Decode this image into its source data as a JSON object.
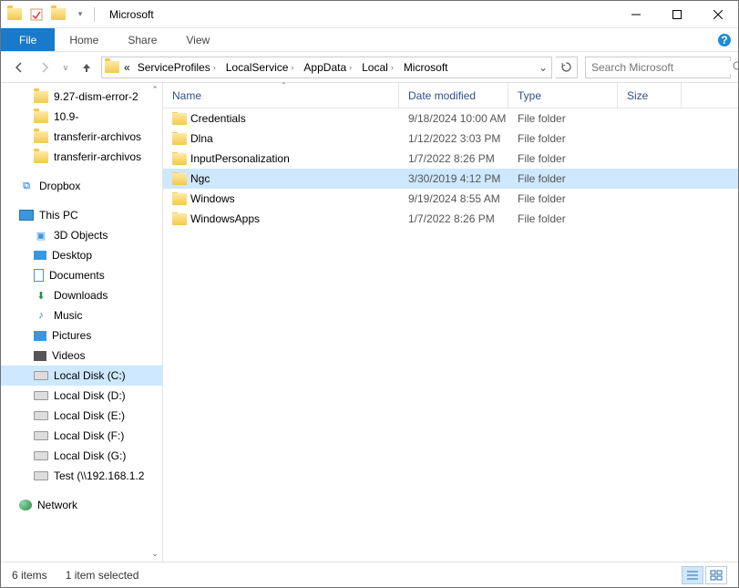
{
  "window": {
    "title": "Microsoft"
  },
  "ribbon": {
    "file": "File",
    "home": "Home",
    "share": "Share",
    "view": "View"
  },
  "breadcrumbs": [
    "ServiceProfiles",
    "LocalService",
    "AppData",
    "Local",
    "Microsoft"
  ],
  "search": {
    "placeholder": "Search Microsoft"
  },
  "tree": {
    "quick": [
      "9.27-dism-error-2",
      "10.9-",
      "transferir-archivos",
      "transferir-archivos"
    ],
    "dropbox": "Dropbox",
    "thispc": "This PC",
    "pc_items": [
      {
        "label": "3D Objects",
        "icon": "cube"
      },
      {
        "label": "Desktop",
        "icon": "desktop"
      },
      {
        "label": "Documents",
        "icon": "doc"
      },
      {
        "label": "Downloads",
        "icon": "down"
      },
      {
        "label": "Music",
        "icon": "music"
      },
      {
        "label": "Pictures",
        "icon": "pic"
      },
      {
        "label": "Videos",
        "icon": "video"
      },
      {
        "label": "Local Disk (C:)",
        "icon": "disk",
        "selected": true
      },
      {
        "label": "Local Disk (D:)",
        "icon": "disk"
      },
      {
        "label": "Local Disk (E:)",
        "icon": "disk"
      },
      {
        "label": "Local Disk (F:)",
        "icon": "disk"
      },
      {
        "label": "Local Disk (G:)",
        "icon": "disk"
      },
      {
        "label": "Test (\\\\192.168.1.2",
        "icon": "disk"
      }
    ],
    "network": "Network"
  },
  "columns": {
    "name": "Name",
    "date": "Date modified",
    "type": "Type",
    "size": "Size"
  },
  "files": [
    {
      "name": "Credentials",
      "date": "9/18/2024 10:00 AM",
      "type": "File folder"
    },
    {
      "name": "Dlna",
      "date": "1/12/2022 3:03 PM",
      "type": "File folder"
    },
    {
      "name": "InputPersonalization",
      "date": "1/7/2022 8:26 PM",
      "type": "File folder"
    },
    {
      "name": "Ngc",
      "date": "3/30/2019 4:12 PM",
      "type": "File folder",
      "selected": true
    },
    {
      "name": "Windows",
      "date": "9/19/2024 8:55 AM",
      "type": "File folder"
    },
    {
      "name": "WindowsApps",
      "date": "1/7/2022 8:26 PM",
      "type": "File folder"
    }
  ],
  "status": {
    "count": "6 items",
    "selection": "1 item selected"
  }
}
